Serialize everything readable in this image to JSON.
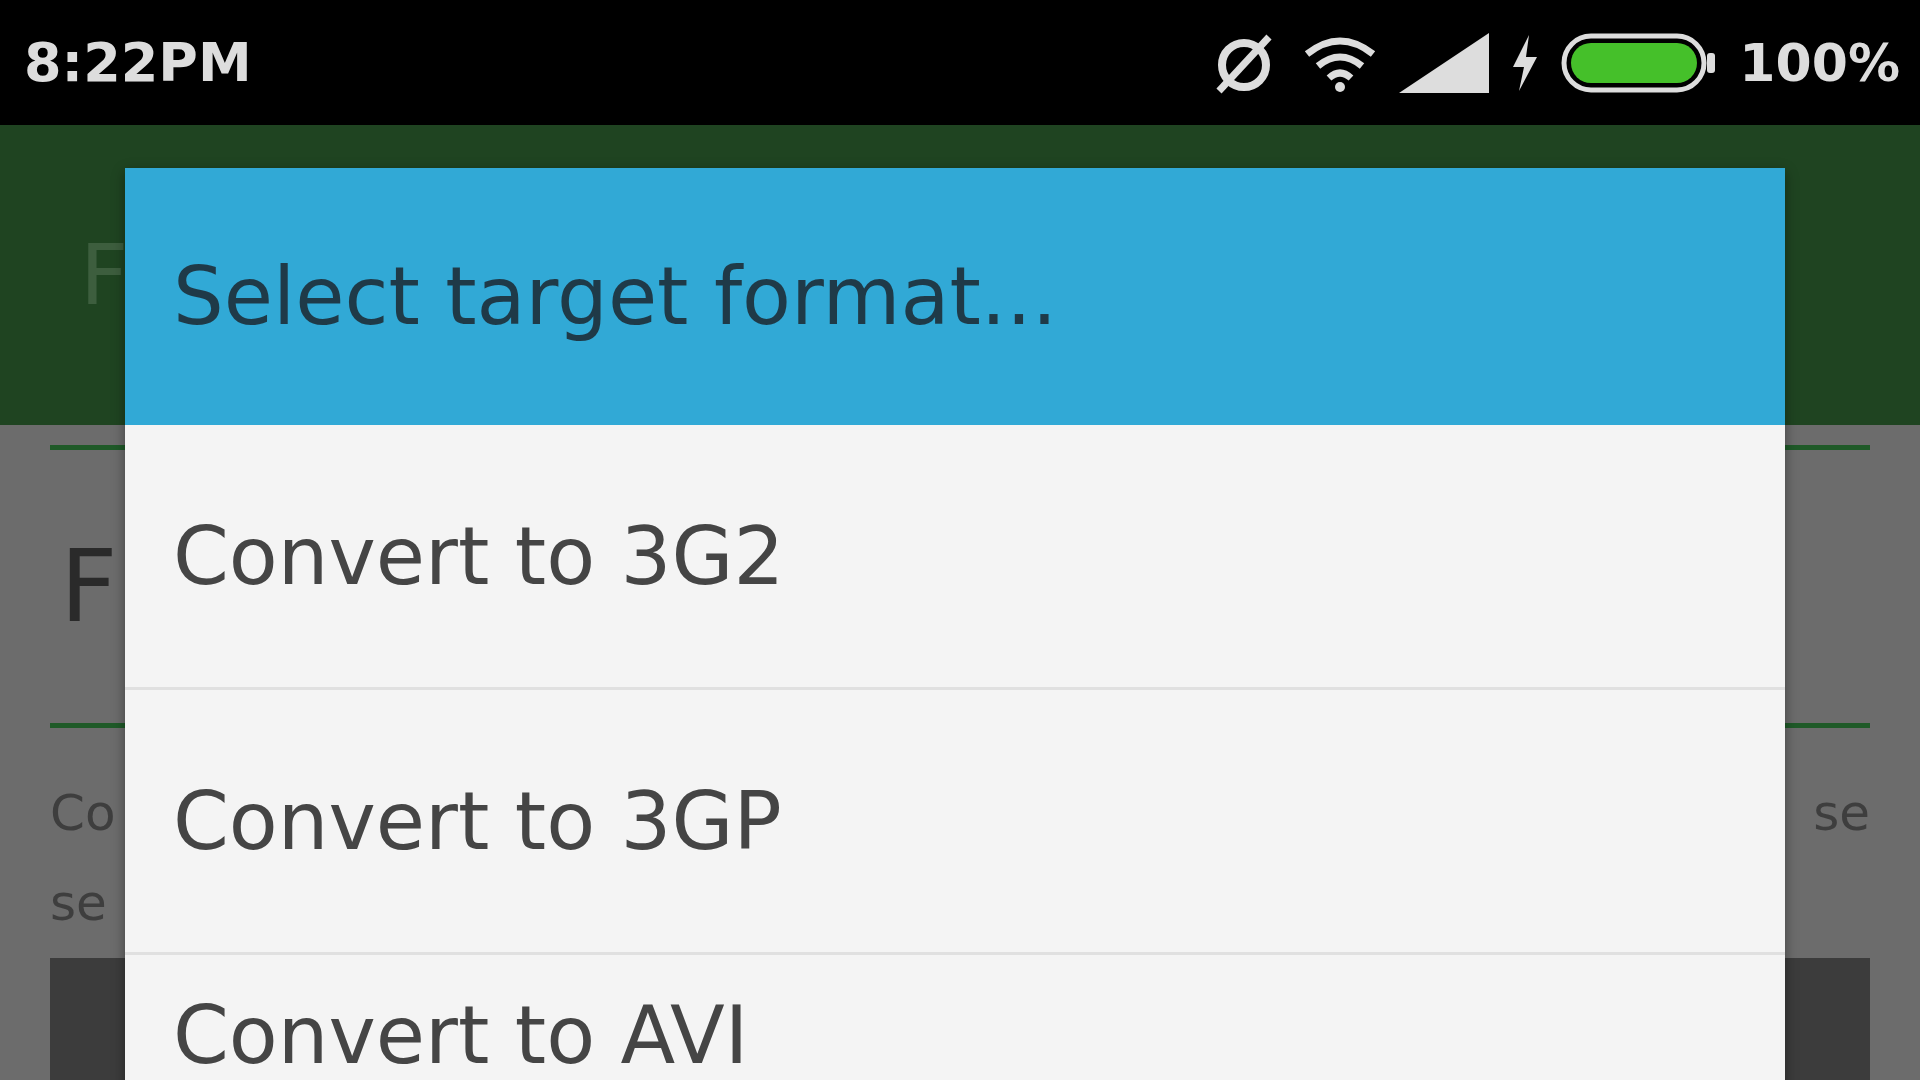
{
  "status_bar": {
    "time": "8:22PM",
    "battery_text": "100%"
  },
  "app_bar": {
    "title": "F"
  },
  "background": {
    "heading": "F",
    "text_left": [
      "Co",
      "se"
    ],
    "text_right": [
      "se"
    ]
  },
  "dialog": {
    "title": "Select target format...",
    "options": [
      {
        "label": "Convert to 3G2"
      },
      {
        "label": "Convert to 3GP"
      },
      {
        "label": "Convert to AVI"
      }
    ]
  }
}
